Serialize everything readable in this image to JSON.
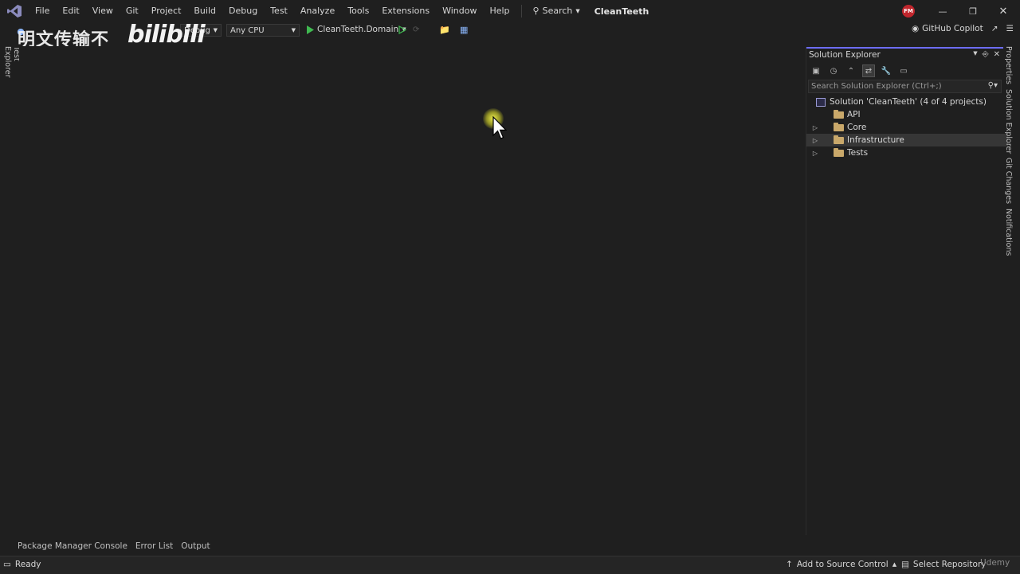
{
  "menu": {
    "items": [
      "File",
      "Edit",
      "View",
      "Git",
      "Project",
      "Build",
      "Debug",
      "Test",
      "Analyze",
      "Tools",
      "Extensions",
      "Window",
      "Help"
    ],
    "search_label": "Search",
    "solution_name": "CleanTeeth",
    "profile_initials": "FM"
  },
  "toolbar": {
    "config": "Debug",
    "platform": "Any CPU",
    "startup_project": "CleanTeeth.Domain",
    "copilot_label": "GitHub Copilot"
  },
  "watermark": {
    "text": "明文传输不",
    "logo": "bilibili"
  },
  "left_tabs": {
    "test_explorer": "Test Explorer"
  },
  "solution_explorer": {
    "title": "Solution Explorer",
    "search_placeholder": "Search Solution Explorer (Ctrl+;)",
    "solution_label": "Solution 'CleanTeeth' (4 of 4 projects)",
    "items": [
      {
        "label": "API",
        "expandable": false,
        "selected": false
      },
      {
        "label": "Core",
        "expandable": true,
        "selected": false
      },
      {
        "label": "Infrastructure",
        "expandable": true,
        "selected": true
      },
      {
        "label": "Tests",
        "expandable": true,
        "selected": false
      }
    ]
  },
  "right_tabs": [
    "Properties",
    "Solution Explorer",
    "Git Changes",
    "Notifications"
  ],
  "bottom_tabs": [
    "Package Manager Console",
    "Error List",
    "Output"
  ],
  "status": {
    "ready": "Ready",
    "source_control": "Add to Source Control",
    "repository": "Select Repository",
    "udemy": "Udemy"
  },
  "colors": {
    "background": "#1f1f1f",
    "accent": "#6d6dff",
    "profile": "#c0262d",
    "run_green": "#3fb950",
    "folder": "#c9a86a",
    "cursor_highlight": "#f0f050"
  }
}
